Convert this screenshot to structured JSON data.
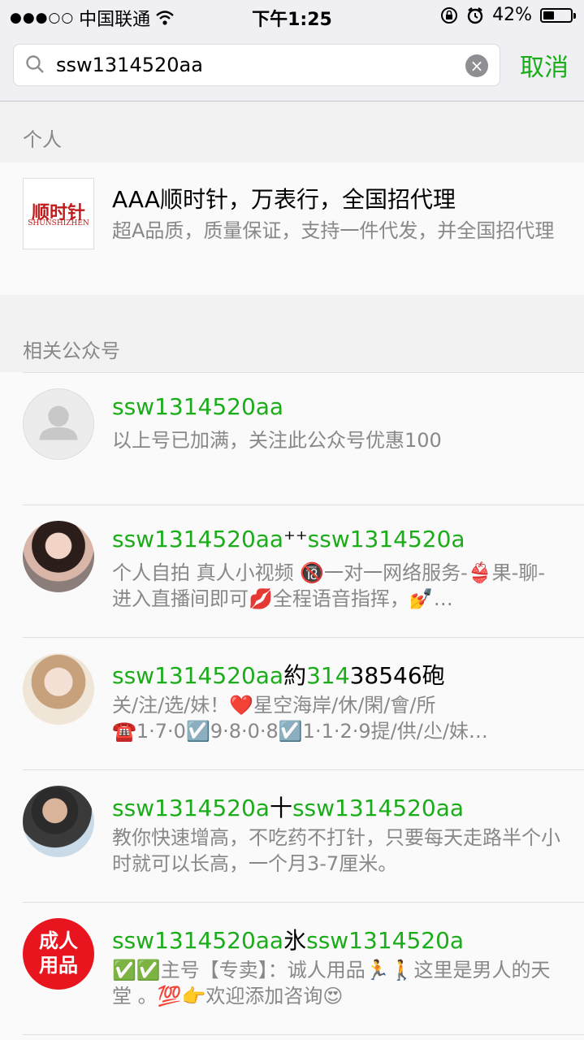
{
  "status_bar": {
    "signal": "●●●○○",
    "carrier": "中国联通",
    "time": "下午1:25",
    "battery": "42%",
    "battery_level": 0.42
  },
  "search": {
    "query": "ssw1314520aa",
    "cancel_label": "取消"
  },
  "personal": {
    "label": "个人",
    "item": {
      "logo_cn": "顺时针",
      "logo_en": "SHUNSHIZHEN",
      "title": "AAA顺时针，万表行，全国招代理",
      "desc": "超A品质，质量保证，支持一件代发，并全国招代理"
    }
  },
  "related": {
    "label": "相关公众号",
    "items": [
      {
        "title_parts": [
          "ssw1314520aa"
        ],
        "desc": "以上号已加满，关注此公众号优惠100"
      },
      {
        "title_parts": [
          "ssw1314520aa",
          "⁺⁺",
          "ssw1314520a"
        ],
        "desc": "个人自拍 真人小视频 🔞一对一网络服务-👙果-聊-进入直播间即可💋全程语音指挥，💅…"
      },
      {
        "title_parts": [
          "ssw1314520aa",
          "約",
          "314",
          "38546砲"
        ],
        "desc": "关/注/选/妹！❤️星空海岸/休/閑/會/所☎️1·7·0☑️9·8·0·8☑️1·1·2·9提/供/尐/妹…"
      },
      {
        "title_parts": [
          "ssw1314520a",
          "十",
          "ssw1314520aa"
        ],
        "desc": "教你快速增高，不吃药不打针，只要每天走路半个小时就可以长高，一个月3-7厘米。"
      },
      {
        "title_parts": [
          "ssw1314520aa",
          "氷",
          "ssw1314520a"
        ],
        "desc": "✅✅主号【专卖】：诚人用品🏃🚶这里是男人的天堂 。💯👉欢迎添加咨询😍",
        "logo_line1": "成人",
        "logo_line2": "用品"
      }
    ]
  },
  "colors": {
    "accent": "#1aad19",
    "secondary_text": "#888888",
    "background": "#f2f2f2"
  }
}
